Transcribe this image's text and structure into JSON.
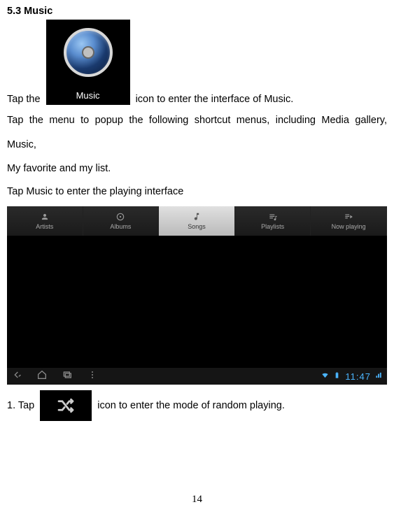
{
  "section": {
    "title": "5.3 Music"
  },
  "para1": {
    "prefix": "Tap the",
    "suffix": "  icon to enter the interface of Music."
  },
  "music_app": {
    "label": "Music"
  },
  "para2_line1": "Tap the menu to popup the following shortcut menus, including Media gallery,",
  "para2_line2": "Music,",
  "para2_line3": "My favorite and my list.",
  "para3": "Tap Music to enter the playing interface",
  "tabs": {
    "artists": "Artists",
    "albums": "Albums",
    "songs": "Songs",
    "playlists": "Playlists",
    "nowplaying": "Now playing"
  },
  "status": {
    "clock": "11:47"
  },
  "item1": {
    "prefix": "1. Tap",
    "suffix": "  icon to enter the mode of random playing."
  },
  "page_number": "14"
}
